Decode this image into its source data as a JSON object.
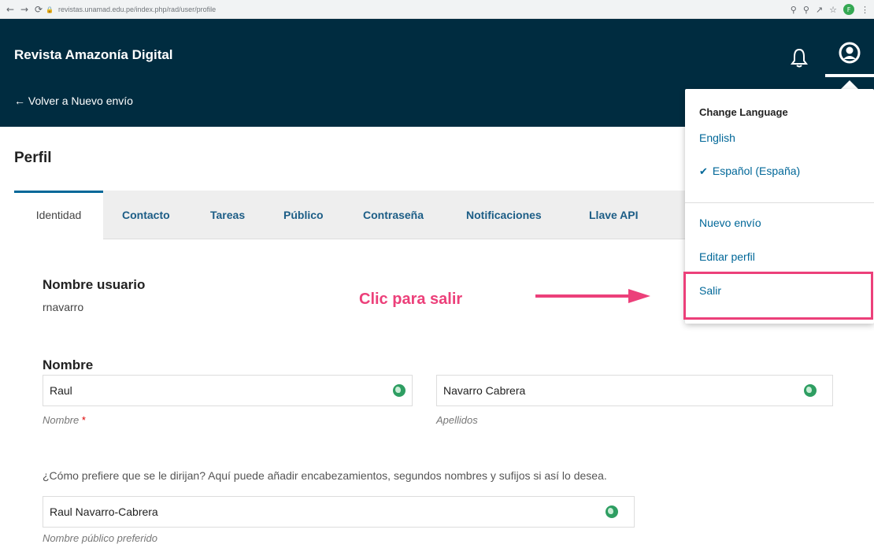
{
  "browser": {
    "url": "revistas.unamad.edu.pe/index.php/rad/user/profile",
    "avatar_letter": "F"
  },
  "header": {
    "site_title": "Revista Amazonía Digital",
    "back_link": "← Volver a Nuevo envío"
  },
  "page": {
    "title": "Perfil",
    "tabs": [
      {
        "label": "Identidad",
        "active": true
      },
      {
        "label": "Contacto"
      },
      {
        "label": "Tareas"
      },
      {
        "label": "Público"
      },
      {
        "label": "Contraseña"
      },
      {
        "label": "Notificaciones"
      },
      {
        "label": "Llave API"
      }
    ]
  },
  "form": {
    "username_label": "Nombre usuario",
    "username_value": "rnavarro",
    "name_section": "Nombre",
    "given_name": "Raul",
    "given_name_hint": "Nombre",
    "required_mark": "*",
    "family_name": "Navarro Cabrera",
    "family_name_hint": "Apellidos",
    "preferred_help": "¿Cómo prefiere que se le dirijan? Aquí puede añadir encabezamientos, segundos nombres y sufijos si así lo desea.",
    "preferred_name": "Raul Navarro-Cabrera",
    "preferred_hint": "Nombre público preferido"
  },
  "annotation": {
    "text": "Clic para salir",
    "color": "#ec407a"
  },
  "user_menu": {
    "heading": "Change Language",
    "languages": [
      {
        "label": "English",
        "selected": false
      },
      {
        "label": "Español (España)",
        "selected": true
      }
    ],
    "items": [
      "Nuevo envío",
      "Editar perfil",
      "Salir"
    ]
  },
  "colors": {
    "header_bg": "#002c40",
    "link": "#006798",
    "tab_text": "#1c5d86",
    "icon_green": "#2e9e62"
  }
}
